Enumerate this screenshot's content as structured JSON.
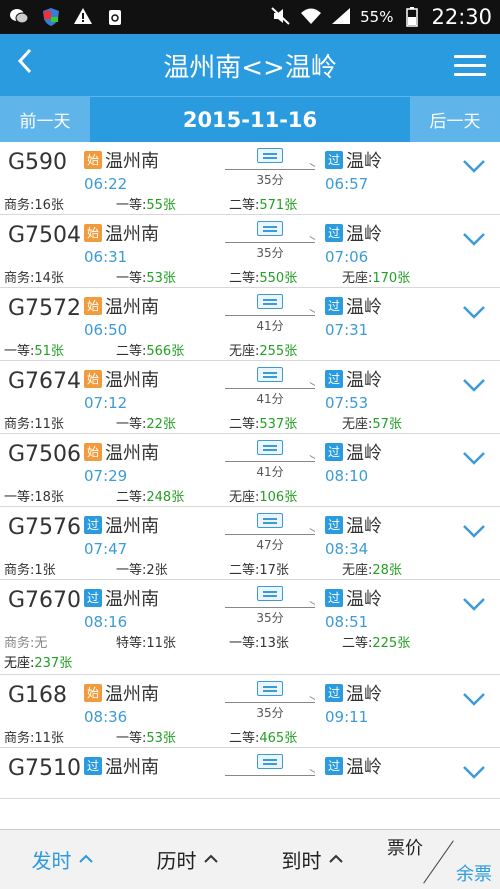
{
  "status_bar": {
    "battery": "55%",
    "time": "22:30"
  },
  "header": {
    "title": "温州南<>温岭"
  },
  "date_nav": {
    "prev_label": "前一天",
    "date": "2015-11-16",
    "next_label": "后一天"
  },
  "trains": [
    {
      "number": "G590",
      "dep_tag": "始",
      "dep_station": "温州南",
      "dep_time": "06:22",
      "duration": "35分",
      "arr_tag": "过",
      "arr_station": "温岭",
      "arr_time": "06:57",
      "seats": [
        {
          "label": "商务:",
          "value": "16张",
          "green": false
        },
        {
          "label": "一等:",
          "value": "55张",
          "green": true
        },
        {
          "label": "二等:",
          "value": "571张",
          "green": true
        }
      ]
    },
    {
      "number": "G7504",
      "dep_tag": "始",
      "dep_station": "温州南",
      "dep_time": "06:31",
      "duration": "35分",
      "arr_tag": "过",
      "arr_station": "温岭",
      "arr_time": "07:06",
      "seats": [
        {
          "label": "商务:",
          "value": "14张",
          "green": false
        },
        {
          "label": "一等:",
          "value": "53张",
          "green": true
        },
        {
          "label": "二等:",
          "value": "550张",
          "green": true
        },
        {
          "label": "无座:",
          "value": "170张",
          "green": true
        }
      ]
    },
    {
      "number": "G7572",
      "dep_tag": "始",
      "dep_station": "温州南",
      "dep_time": "06:50",
      "duration": "41分",
      "arr_tag": "过",
      "arr_station": "温岭",
      "arr_time": "07:31",
      "seats": [
        {
          "label": "一等:",
          "value": "51张",
          "green": true
        },
        {
          "label": "二等:",
          "value": "566张",
          "green": true
        },
        {
          "label": "无座:",
          "value": "255张",
          "green": true
        }
      ]
    },
    {
      "number": "G7674",
      "dep_tag": "始",
      "dep_station": "温州南",
      "dep_time": "07:12",
      "duration": "41分",
      "arr_tag": "过",
      "arr_station": "温岭",
      "arr_time": "07:53",
      "seats": [
        {
          "label": "商务:",
          "value": "11张",
          "green": false
        },
        {
          "label": "一等:",
          "value": "22张",
          "green": true
        },
        {
          "label": "二等:",
          "value": "537张",
          "green": true
        },
        {
          "label": "无座:",
          "value": "57张",
          "green": true
        }
      ]
    },
    {
      "number": "G7506",
      "dep_tag": "始",
      "dep_station": "温州南",
      "dep_time": "07:29",
      "duration": "41分",
      "arr_tag": "过",
      "arr_station": "温岭",
      "arr_time": "08:10",
      "seats": [
        {
          "label": "一等:",
          "value": "18张",
          "green": false
        },
        {
          "label": "二等:",
          "value": "248张",
          "green": true
        },
        {
          "label": "无座:",
          "value": "106张",
          "green": true
        }
      ]
    },
    {
      "number": "G7576",
      "dep_tag": "过",
      "dep_station": "温州南",
      "dep_time": "07:47",
      "duration": "47分",
      "arr_tag": "过",
      "arr_station": "温岭",
      "arr_time": "08:34",
      "seats": [
        {
          "label": "商务:",
          "value": "1张",
          "green": false
        },
        {
          "label": "一等:",
          "value": "2张",
          "green": false
        },
        {
          "label": "二等:",
          "value": "17张",
          "green": false
        },
        {
          "label": "无座:",
          "value": "28张",
          "green": true
        }
      ]
    },
    {
      "number": "G7670",
      "dep_tag": "过",
      "dep_station": "温州南",
      "dep_time": "08:16",
      "duration": "35分",
      "arr_tag": "过",
      "arr_station": "温岭",
      "arr_time": "08:51",
      "seats": [
        {
          "label": "商务:",
          "value": "无",
          "green": false,
          "muted": true
        },
        {
          "label": "特等:",
          "value": "11张",
          "green": false
        },
        {
          "label": "一等:",
          "value": "13张",
          "green": false
        },
        {
          "label": "二等:",
          "value": "225张",
          "green": true
        }
      ],
      "seats2": [
        {
          "label": "无座:",
          "value": "237张",
          "green": true
        }
      ]
    },
    {
      "number": "G168",
      "dep_tag": "始",
      "dep_station": "温州南",
      "dep_time": "08:36",
      "duration": "35分",
      "arr_tag": "过",
      "arr_station": "温岭",
      "arr_time": "09:11",
      "seats": [
        {
          "label": "商务:",
          "value": "11张",
          "green": false
        },
        {
          "label": "一等:",
          "value": "53张",
          "green": true
        },
        {
          "label": "二等:",
          "value": "465张",
          "green": true
        }
      ]
    },
    {
      "number": "G7510",
      "dep_tag": "过",
      "dep_station": "温州南",
      "dep_time": "",
      "duration": "",
      "arr_tag": "过",
      "arr_station": "温岭",
      "arr_time": "",
      "seats": []
    }
  ],
  "bottom_bar": {
    "sort_depart": "发时",
    "sort_duration": "历时",
    "sort_arrive": "到时",
    "price_label": "票价",
    "remaining_label": "余票"
  },
  "colors": {
    "accent": "#2b9be0",
    "origin_tag": "#f29b3c",
    "pass_tag": "#2b9be0",
    "available": "#22a022"
  }
}
